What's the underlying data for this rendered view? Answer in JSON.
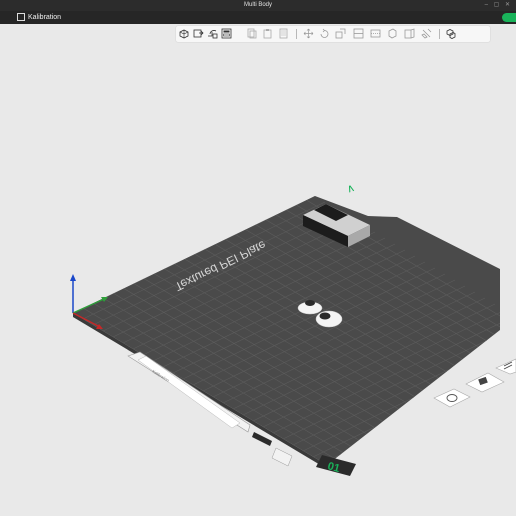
{
  "window": {
    "title": "Multi Body"
  },
  "menubar": {
    "tab_label": "Kalibration"
  },
  "toolbar": {
    "buttons": [
      "add-part-icon",
      "import-icon",
      "auto-orient-icon",
      "arrange-icon",
      "copy-icon",
      "paste-icon",
      "layers-icon",
      "move-icon",
      "rotate-icon",
      "scale-icon",
      "split-icon",
      "cut-icon",
      "place-on-face-icon",
      "support-paint-icon",
      "seam-paint-icon",
      "assembly-icon"
    ]
  },
  "plate": {
    "label": "Textured PEI Plate",
    "plate_number": "01",
    "corner_mark": "∧",
    "tray_label": "Kalibration"
  },
  "colors": {
    "accent": "#19b35a",
    "bed": "#4a4a4a",
    "grid": "#5c5c5c",
    "axis_x": "#c62828",
    "axis_y": "#2e9e3a",
    "axis_z": "#1a47c9",
    "background": "#e9e9e9"
  }
}
